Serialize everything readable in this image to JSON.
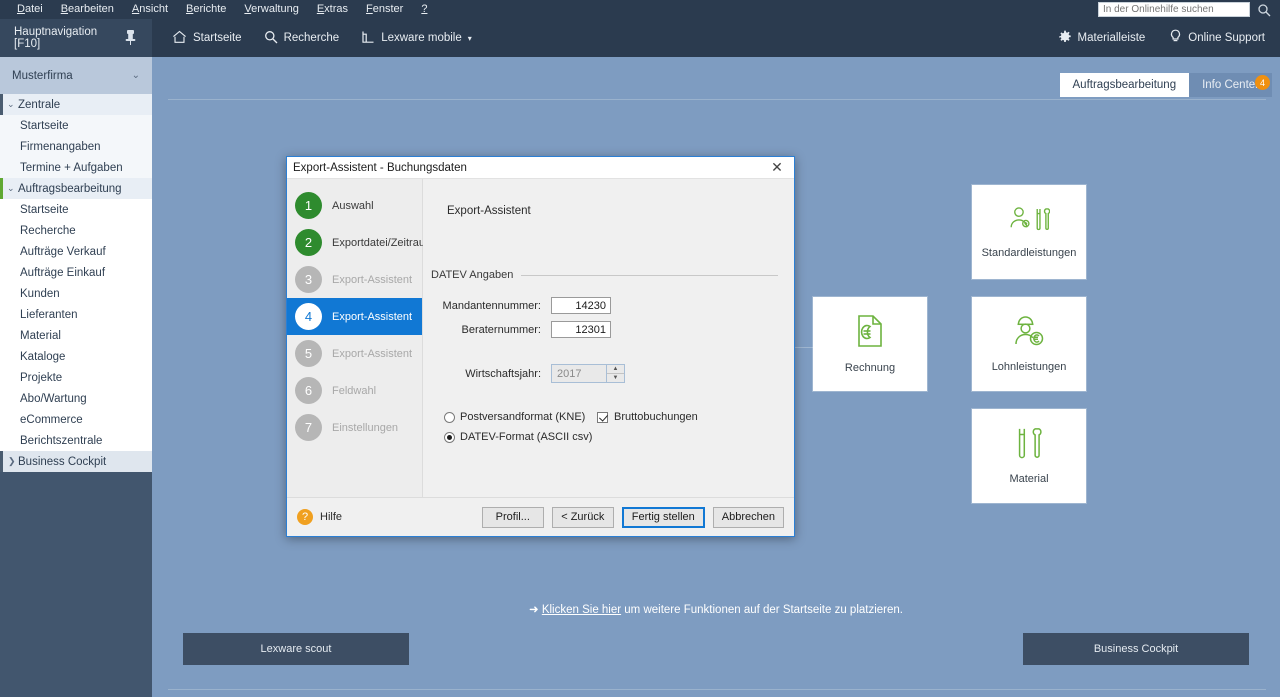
{
  "menubar": {
    "items": [
      "Datei",
      "Bearbeiten",
      "Ansicht",
      "Berichte",
      "Verwaltung",
      "Extras",
      "Fenster",
      "?"
    ],
    "search_placeholder": "In der Onlinehilfe suchen",
    "search_value": ""
  },
  "toolbar": {
    "nav_label": "Hauptnavigation [F10]",
    "items": [
      {
        "label": "Startseite",
        "icon": "home-icon"
      },
      {
        "label": "Recherche",
        "icon": "search-icon"
      },
      {
        "label": "Lexware mobile",
        "icon": "mobile-icon"
      }
    ],
    "right_items": [
      {
        "label": "Materialleiste",
        "icon": "gear-icon"
      },
      {
        "label": "Online Support",
        "icon": "bulb-icon"
      }
    ]
  },
  "sidebar": {
    "company": "Musterfirma",
    "groups": [
      {
        "label": "Zentrale",
        "marker_color": "#4a5c70",
        "items": [
          "Startseite",
          "Firmenangaben",
          "Termine + Aufgaben"
        ]
      },
      {
        "label": "Auftragsbearbeitung",
        "marker_color": "#5fa832",
        "items": [
          "Startseite",
          "Recherche",
          "Aufträge Verkauf",
          "Aufträge Einkauf",
          "Kunden",
          "Lieferanten",
          "Material",
          "Kataloge",
          "Projekte",
          "Abo/Wartung",
          "eCommerce",
          "Berichtszentrale"
        ]
      }
    ],
    "bottom_item": "Business Cockpit"
  },
  "workspace": {
    "tabs": [
      {
        "label": "Auftragsbearbeitung",
        "active": true,
        "badge": ""
      },
      {
        "label": "Info Center",
        "active": false,
        "badge": "4"
      }
    ],
    "tiles": [
      {
        "label": "Standardleistungen",
        "icon": "person-tools-icon"
      },
      {
        "label": "Rechnung",
        "icon": "euro-document-icon"
      },
      {
        "label": "Lohnleistungen",
        "icon": "worker-euro-icon"
      },
      {
        "label": "Material",
        "icon": "tools-icon"
      }
    ],
    "hint_arrow": "➜",
    "hint_link": "Klicken Sie hier",
    "hint_text": " um weitere Funktionen auf der Startseite zu platzieren.",
    "buttons": [
      {
        "label": "Lexware scout"
      },
      {
        "label": "Business Cockpit"
      }
    ]
  },
  "dialog": {
    "title": "Export-Assistent - Buchungsdaten",
    "close_glyph": "✕",
    "steps": [
      {
        "num": "1",
        "label": "Auswahl",
        "state": "done"
      },
      {
        "num": "2",
        "label": "Exportdatei/Zeitraum",
        "state": "done"
      },
      {
        "num": "3",
        "label": "Export-Assistent",
        "state": "todo"
      },
      {
        "num": "4",
        "label": "Export-Assistent",
        "state": "current"
      },
      {
        "num": "5",
        "label": "Export-Assistent",
        "state": "todo"
      },
      {
        "num": "6",
        "label": "Feldwahl",
        "state": "todo"
      },
      {
        "num": "7",
        "label": "Einstellungen",
        "state": "todo"
      }
    ],
    "pane_title": "Export-Assistent",
    "group_label": "DATEV Angaben",
    "fields": [
      {
        "label": "Mandantennummer:",
        "value": "14230"
      },
      {
        "label": "Beraternummer:",
        "value": "12301"
      }
    ],
    "year_label": "Wirtschaftsjahr:",
    "year_value": "2017",
    "radio_options": [
      {
        "label": "Postversandformat (KNE)",
        "selected": false
      },
      {
        "label": "DATEV-Format (ASCII csv)",
        "selected": true
      }
    ],
    "checkbox": {
      "label": "Bruttobuchungen",
      "checked": true
    },
    "help_label": "Hilfe",
    "help_glyph": "?",
    "buttons": [
      {
        "label": "Profil...",
        "default": false
      },
      {
        "label": "< Zurück",
        "default": false
      },
      {
        "label": "Fertig stellen",
        "default": true
      },
      {
        "label": "Abbrechen",
        "default": false
      }
    ]
  },
  "colors": {
    "chrome": "#2b3b4f",
    "workspace": "#7e9cc1",
    "accent_blue": "#1178d4",
    "green": "#6db33f",
    "orange": "#f0900f"
  }
}
